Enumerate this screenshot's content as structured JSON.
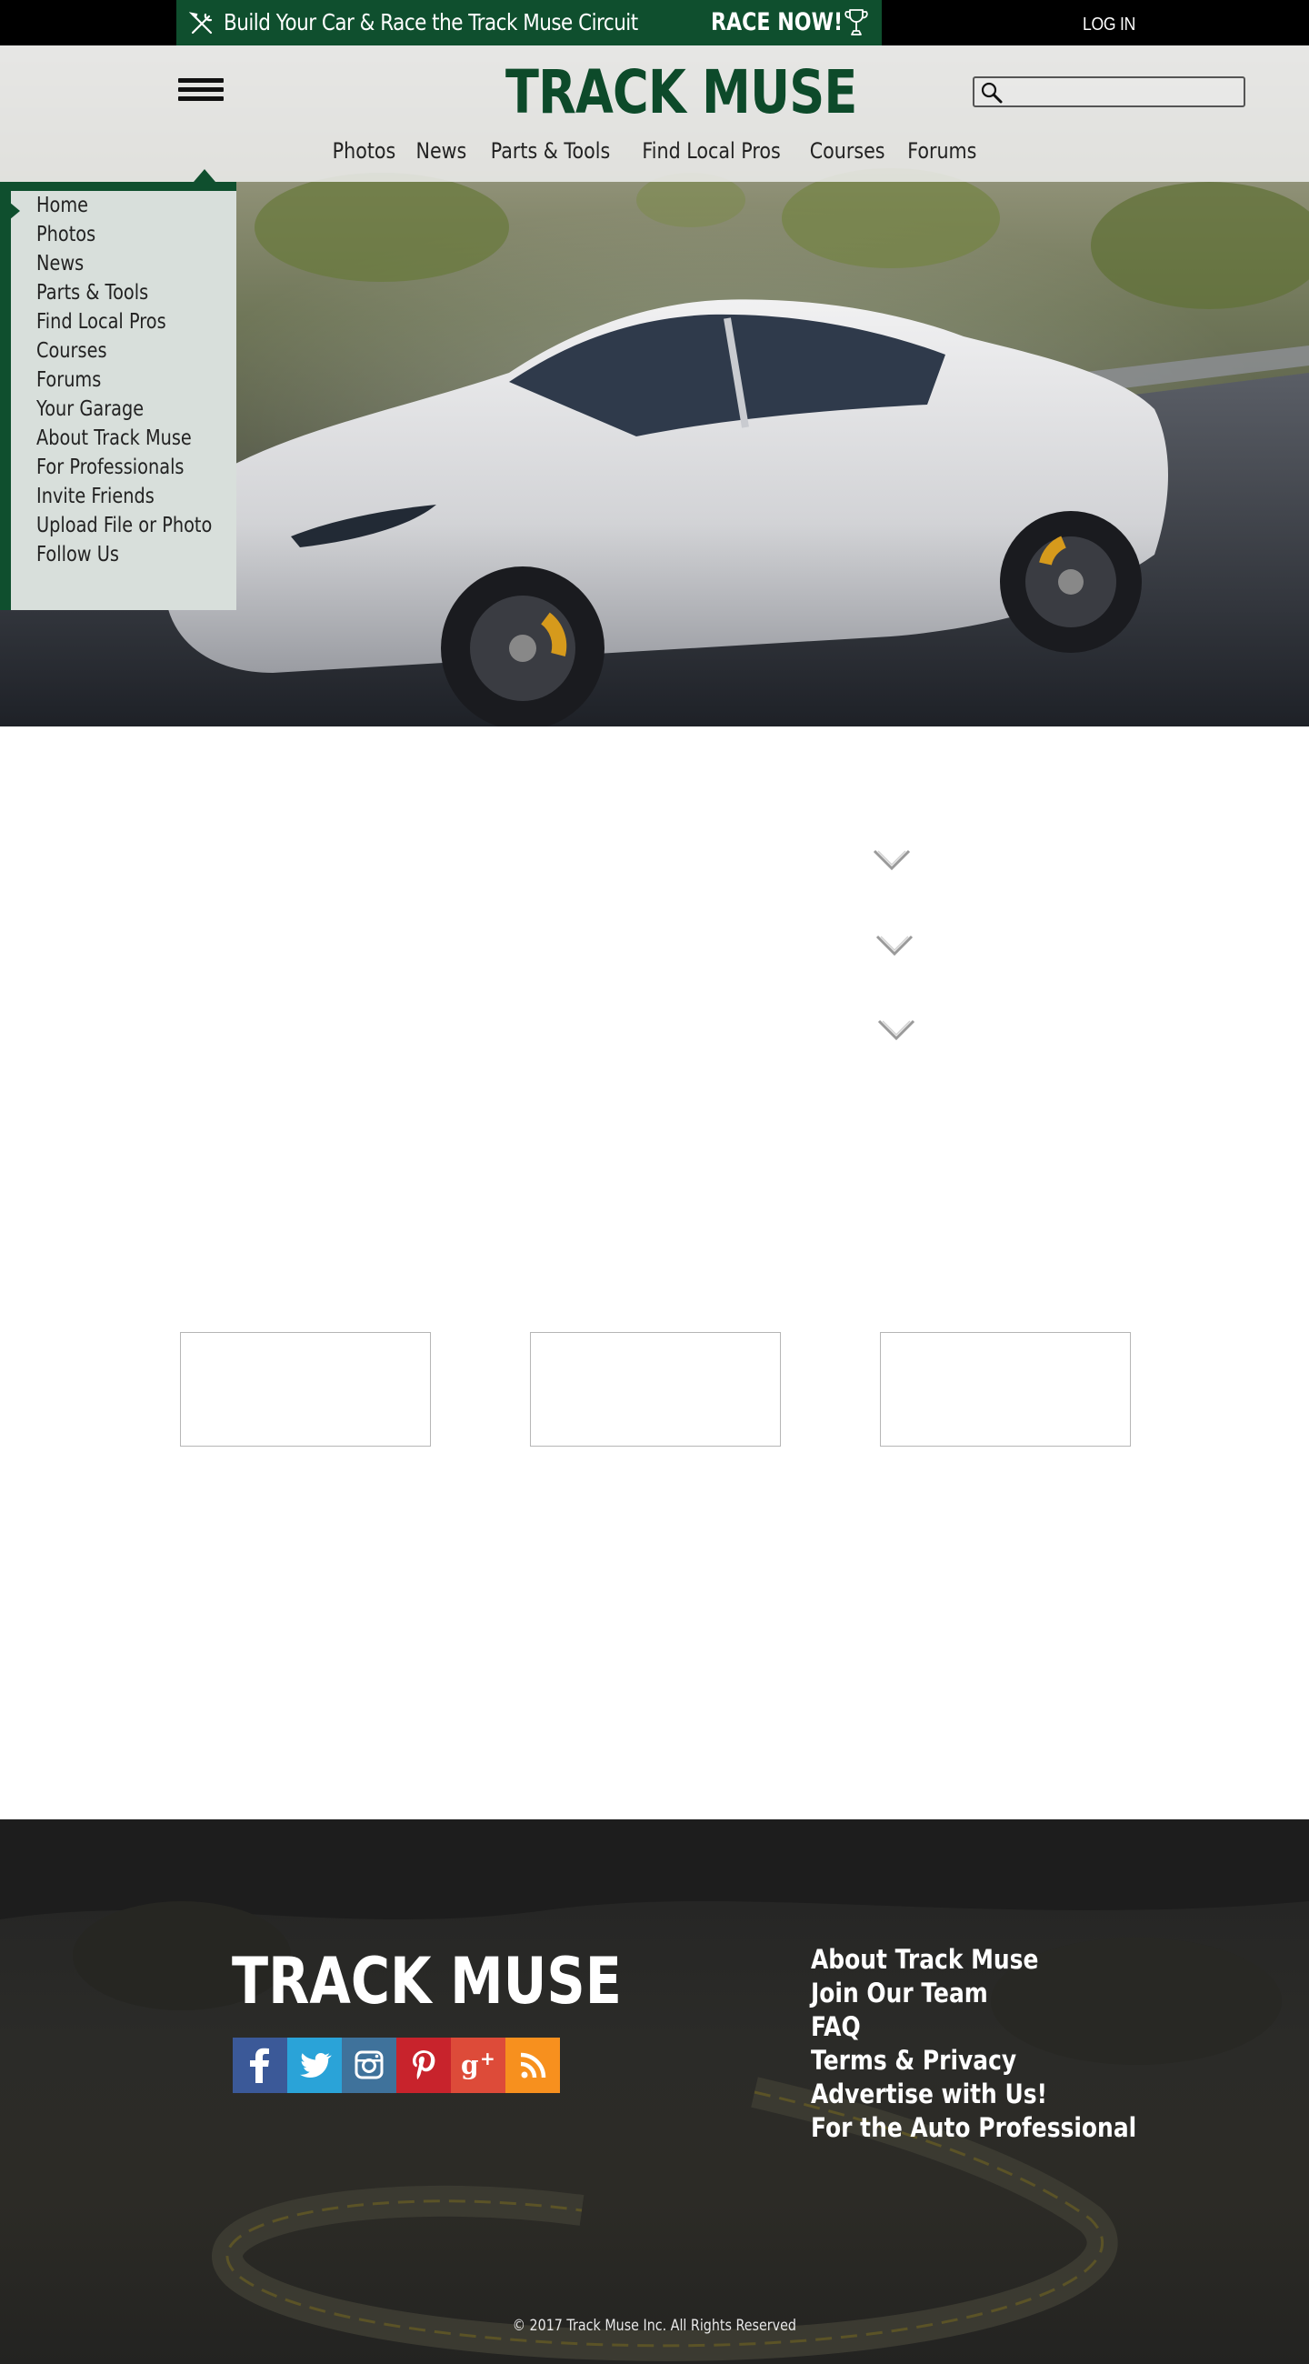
{
  "promo": {
    "text": "Build Your Car & Race the Track Muse Circuit",
    "cta": "RACE NOW!",
    "icons": {
      "left": "tools-icon",
      "right": "trophy-icon"
    }
  },
  "header": {
    "login_label": "LOG IN",
    "logo_text": "TRACK MUSE",
    "search_placeholder": "",
    "search_icon": "search-icon",
    "menu_icon": "hamburger-icon"
  },
  "nav": {
    "items": [
      "Photos",
      "News",
      "Parts & Tools",
      "Find Local Pros",
      "Courses",
      "Forums"
    ]
  },
  "side_menu": {
    "items": [
      "Home",
      "Photos",
      "News",
      "Parts & Tools",
      "Find Local Pros",
      "Courses",
      "Forums",
      "Your Garage",
      "About Track Muse",
      "For Professionals",
      "Invite Friends",
      "Upload File or Photo",
      "Follow Us"
    ]
  },
  "accordion": {
    "icon": "chevron-down-icon",
    "count": 3
  },
  "cards": {
    "count": 3
  },
  "footer": {
    "logo_text": "TRACK MUSE",
    "social": [
      {
        "name": "facebook",
        "icon": "facebook-icon",
        "color": "#3b5998"
      },
      {
        "name": "twitter",
        "icon": "twitter-icon",
        "color": "#2aa3d8"
      },
      {
        "name": "instagram",
        "icon": "instagram-icon",
        "color": "#3f729b"
      },
      {
        "name": "pinterest",
        "icon": "pinterest-icon",
        "color": "#c8232c"
      },
      {
        "name": "google-plus",
        "icon": "google-plus-icon",
        "color": "#dd4b39"
      },
      {
        "name": "rss",
        "icon": "rss-icon",
        "color": "#f7901e"
      }
    ],
    "links": [
      "About Track Muse",
      "Join Our Team",
      "FAQ",
      "Terms & Privacy",
      "Advertise with Us!",
      "For the Auto Professional"
    ],
    "copyright": "© 2017 Track Muse Inc. All Rights Reserved"
  },
  "colors": {
    "brand_green": "#0f4f2e",
    "logo_green": "#0d4a2a",
    "top_bar": "#000000",
    "footer_bg": "#2a2a27"
  }
}
